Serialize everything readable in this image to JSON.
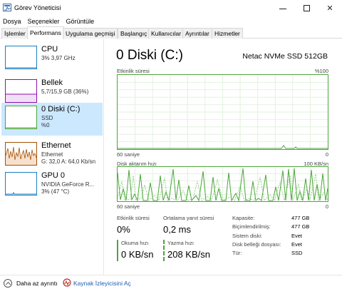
{
  "window": {
    "title": "Görev Yöneticisi"
  },
  "menu": [
    "Dosya",
    "Seçenekler",
    "Görüntüle"
  ],
  "tabs": [
    "İşlemler",
    "Performans",
    "Uygulama geçmişi",
    "Başlangıç",
    "Kullanıcılar",
    "Ayrıntılar",
    "Hizmetler"
  ],
  "active_tab": "Performans",
  "resources": [
    {
      "name": "CPU",
      "line1": "3% 3,97 GHz",
      "line2": "",
      "line3": "",
      "color": "#1a7fc4"
    },
    {
      "name": "Bellek",
      "line1": "5,7/15,9 GB (36%)",
      "line2": "",
      "line3": "",
      "color": "#8b12ae"
    },
    {
      "name": "0 Diski (C:)",
      "line1": "SSD",
      "line2": "%0",
      "line3": "",
      "color": "#4ca63b",
      "selected": true
    },
    {
      "name": "Ethernet",
      "line1": "Ethernet",
      "line2": "G: 32,0  A: 64,0 Kb/sn",
      "line3": "",
      "color": "#a74f01"
    },
    {
      "name": "GPU 0",
      "line1": "NVIDIA GeForce R...",
      "line2": "3% (47 °C)",
      "line3": "",
      "color": "#1a7fc4"
    }
  ],
  "detail": {
    "title": "0 Diski (C:)",
    "model": "Netac NVMe SSD 512GB",
    "graph1": {
      "label": "Etkinlik süresi",
      "max_label": "%100",
      "time_label": "60 saniye",
      "min_label": "0"
    },
    "graph2": {
      "label": "Disk aktarım hızı",
      "max_label": "100 KB/sn",
      "time_label": "60 saniye",
      "min_label": "0"
    },
    "activity_label": "Etkinlik süresi",
    "activity_value": "0%",
    "response_label": "Ortalama yanıt süresi",
    "response_value": "0,2 ms",
    "read_label": "Okuma hızı",
    "read_value": "0 KB/sn",
    "write_label": "Yazma hızı",
    "write_value": "208 KB/sn",
    "properties": [
      {
        "key": "Kapasite:",
        "value": "477 GB"
      },
      {
        "key": "Biçimlendirilmiş:",
        "value": "477 GB"
      },
      {
        "key": "Sistem diski:",
        "value": "Evet"
      },
      {
        "key": "Disk belleği dosyası:",
        "value": "Evet"
      },
      {
        "key": "Tür:",
        "value": "SSD"
      }
    ]
  },
  "footer": {
    "less_details": "Daha az ayrıntı",
    "resource_monitor": "Kaynak İzleyicisini Aç"
  },
  "colors": {
    "disk_green": "#4ca63b",
    "selected_bg": "#cce8ff",
    "link": "#1a5fb4"
  }
}
